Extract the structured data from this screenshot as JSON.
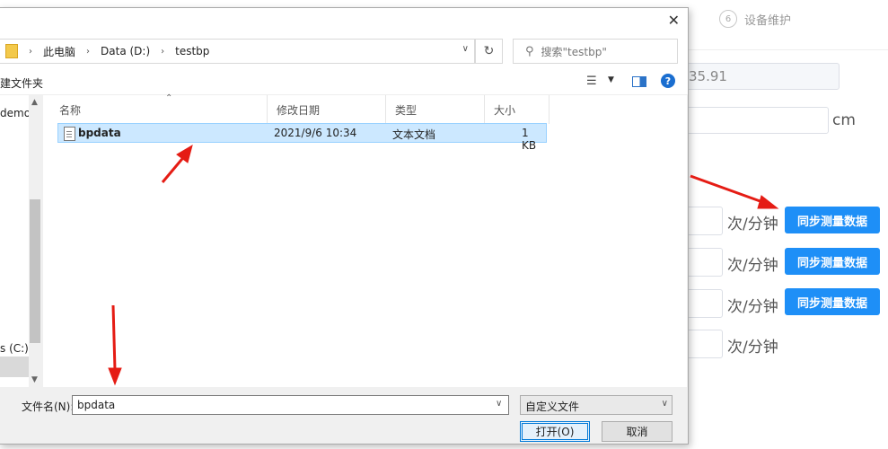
{
  "background_page": {
    "step": {
      "number": "6",
      "label": "设备维护"
    },
    "readonly_value": "35.91",
    "height_unit": "cm",
    "rate_unit": "次/分钟",
    "sync_button_label": "同步测量数据"
  },
  "dialog": {
    "close_glyph": "✕",
    "address": {
      "crumbs": [
        "此电脑",
        "Data (D:)",
        "testbp"
      ],
      "separator": "›"
    },
    "search": {
      "placeholder": "搜索\"testbp\""
    },
    "toolbar": {
      "new_folder": "建文件夹",
      "help": "?"
    },
    "nav": {
      "items": [
        "demoP",
        "s (C:)"
      ]
    },
    "columns": {
      "name": "名称",
      "modified": "修改日期",
      "type": "类型",
      "size": "大小"
    },
    "files": [
      {
        "name": "bpdata",
        "modified": "2021/9/6 10:34",
        "type": "文本文档",
        "size": "1 KB"
      }
    ],
    "filename_label": "文件名(N):",
    "filename_value": "bpdata",
    "filetype_value": "自定义文件",
    "open_button": "打开(O)",
    "cancel_button": "取消"
  },
  "colors": {
    "accent": "#1e8ff7",
    "selection": "#cce8ff",
    "arrow": "#e51c14"
  }
}
